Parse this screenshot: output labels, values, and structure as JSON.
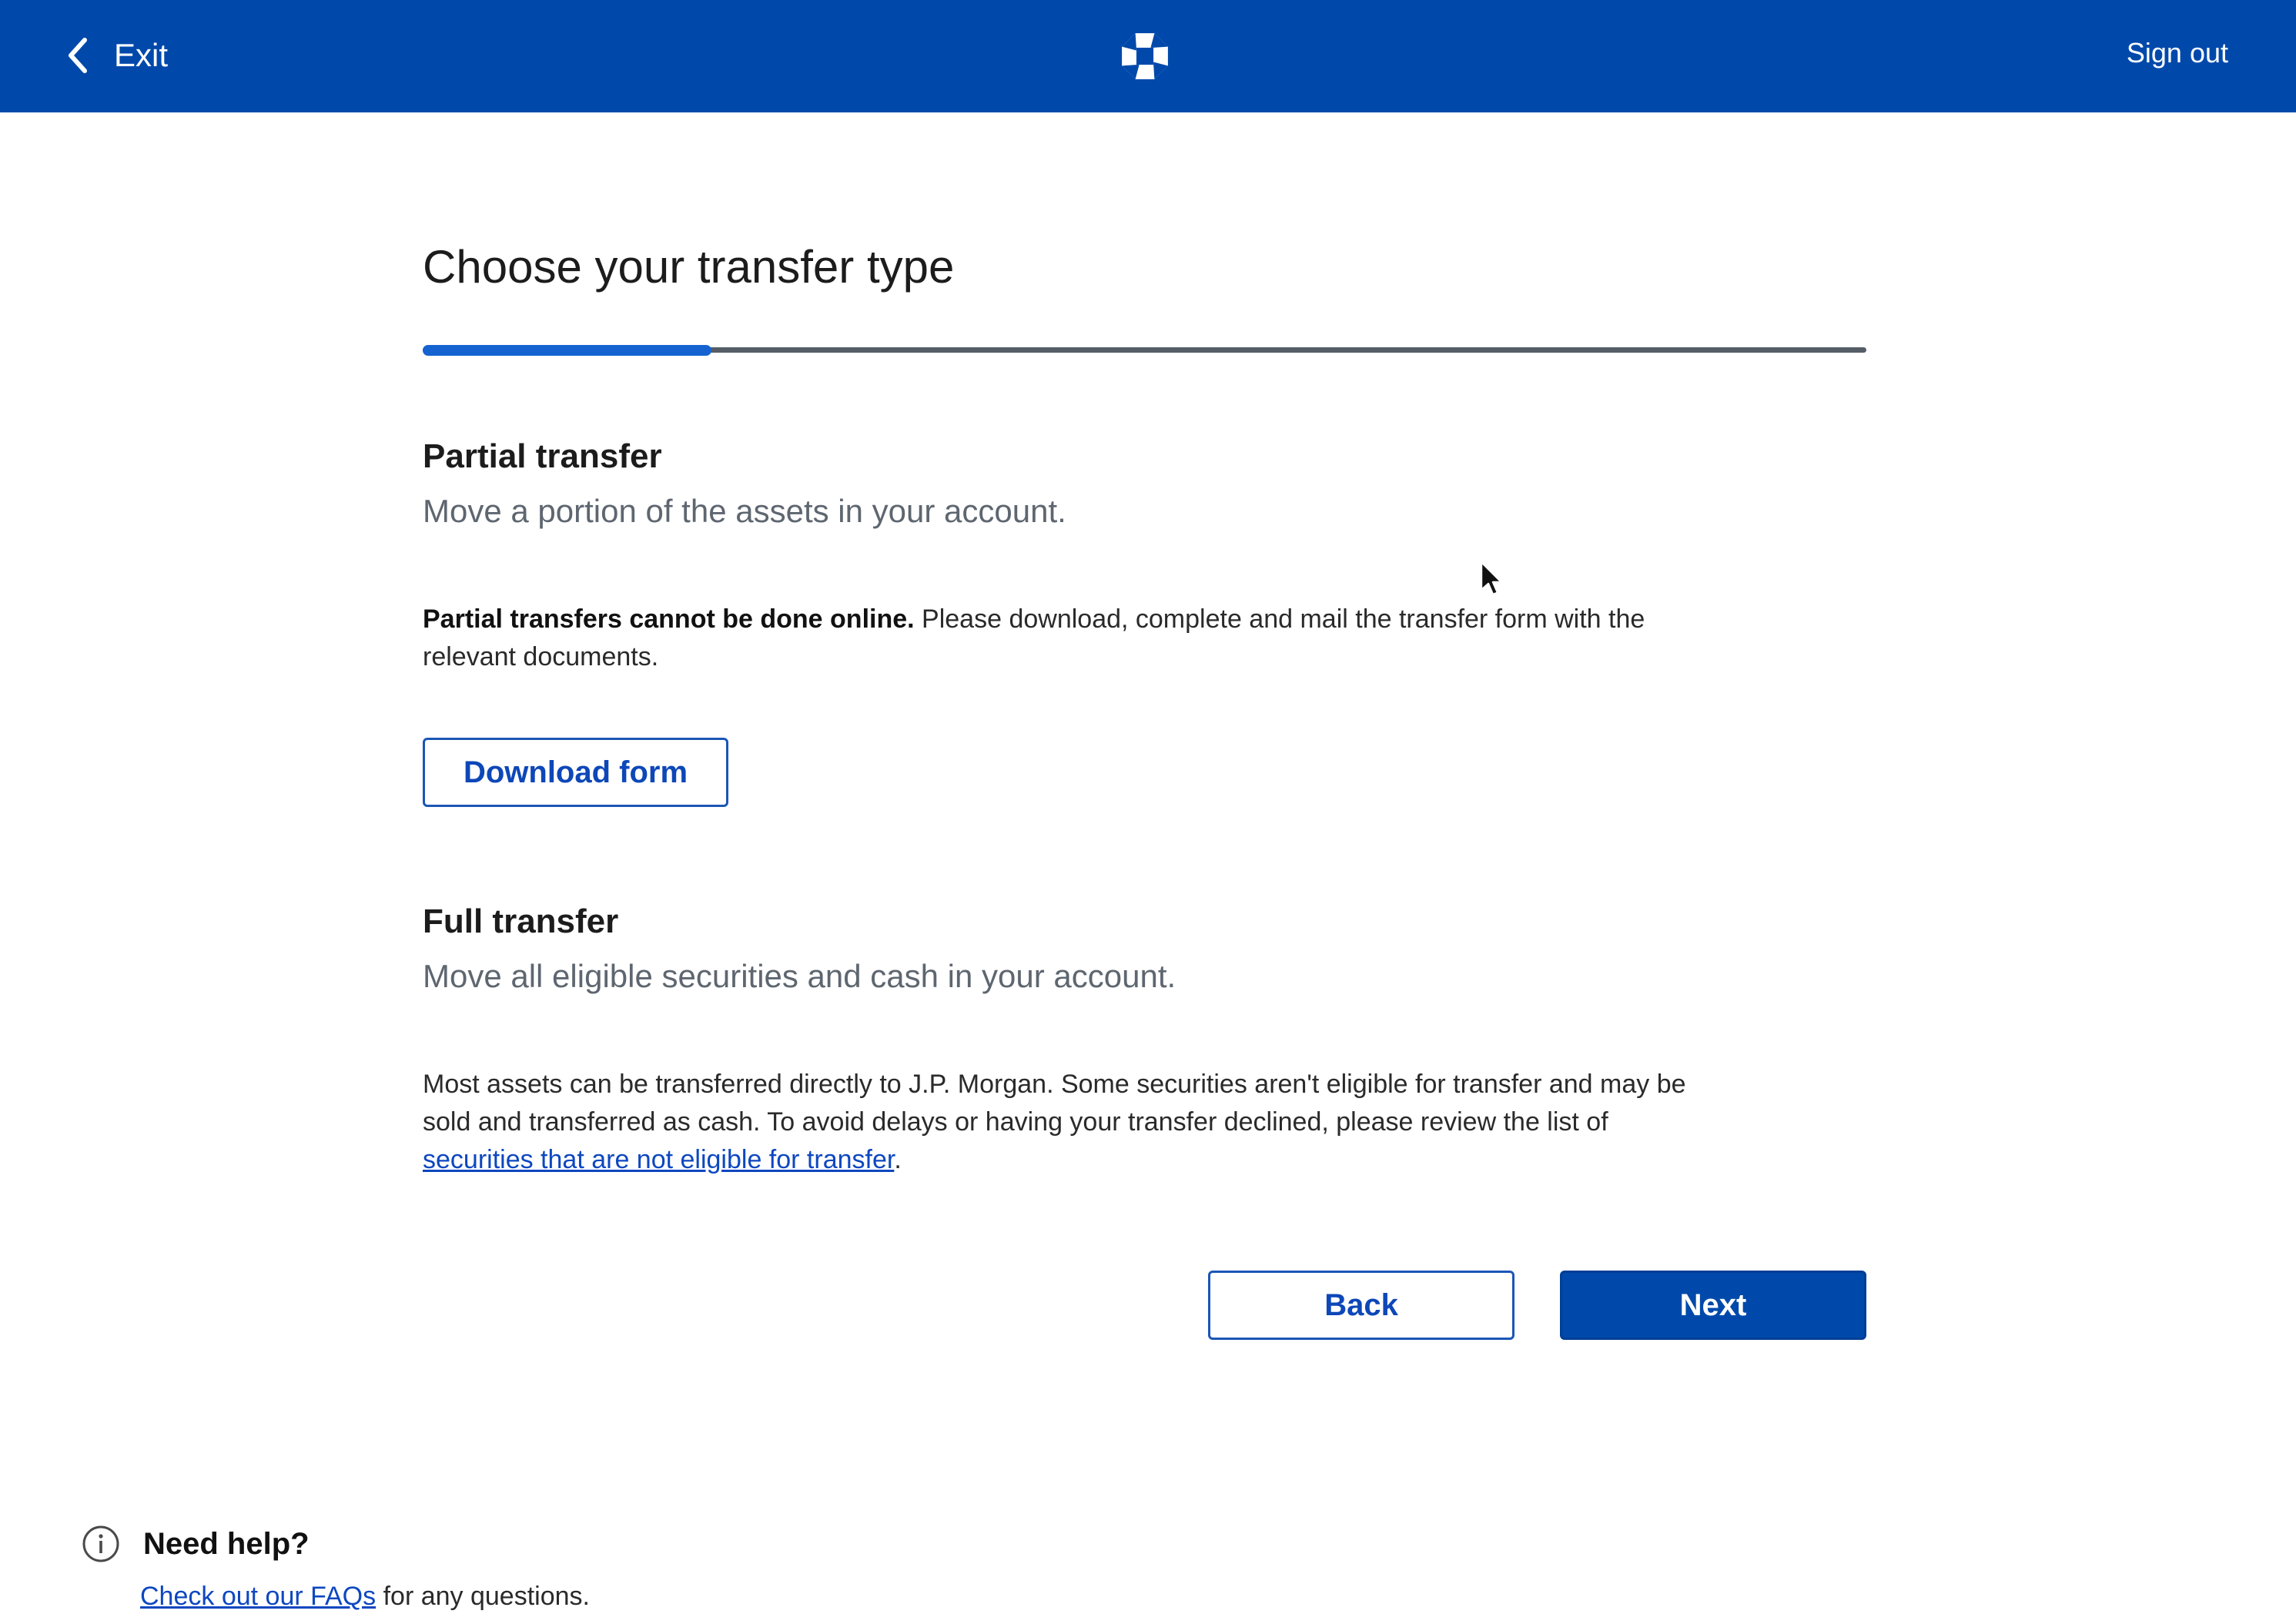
{
  "header": {
    "exit_label": "Exit",
    "sign_out_label": "Sign out",
    "logo_icon": "chase-octagon-logo",
    "background_color": "#0049ab"
  },
  "main": {
    "title": "Choose your transfer type",
    "progress_fraction": 0.2,
    "partial": {
      "heading": "Partial transfer",
      "subheading": "Move a portion of the assets in your account.",
      "notice_bold": "Partial transfers cannot be done online.",
      "notice_text": " Please download, complete and mail the transfer form with the relevant documents.",
      "download_button": "Download form"
    },
    "full": {
      "heading": "Full transfer",
      "subheading": "Move all eligible securities and cash in your account.",
      "body_text": "Most assets can be transferred directly to J.P. Morgan. Some securities aren't eligible for transfer and may be sold and transferred as cash. To avoid delays or having your transfer declined, please review the list of ",
      "link_text": "securities that are not eligible for transfer",
      "body_end": "."
    },
    "buttons": {
      "back": "Back",
      "next": "Next"
    }
  },
  "help": {
    "icon": "info-circle-icon",
    "title": "Need help?",
    "link_text": "Check out our FAQs",
    "suffix": " for any questions."
  },
  "colors": {
    "accent": "#0049ab",
    "progress_fill": "#1563d1",
    "progress_track": "#555d66",
    "link": "#0d47c0"
  }
}
